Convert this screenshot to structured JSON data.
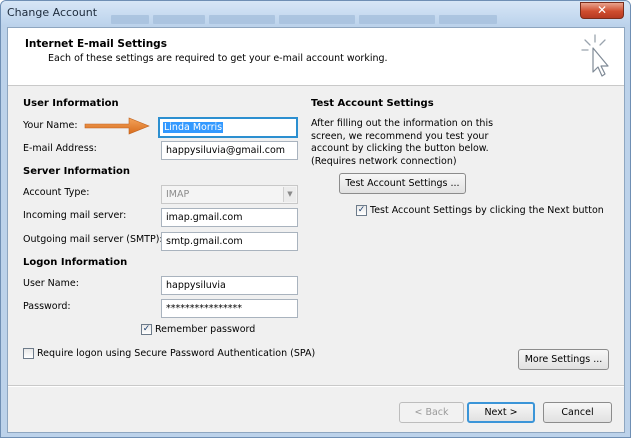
{
  "window": {
    "title": "Change Account",
    "close_glyph": "✕"
  },
  "header": {
    "title": "Internet E-mail Settings",
    "subtitle": "Each of these settings are required to get your e-mail account working.",
    "icon": "cursor-click-icon"
  },
  "user_info": {
    "heading": "User Information",
    "name_label": "Your Name:",
    "name_value": "Linda Morris",
    "email_label": "E-mail Address:",
    "email_value": "happysiluvia@gmail.com"
  },
  "server_info": {
    "heading": "Server Information",
    "account_type_label": "Account Type:",
    "account_type_value": "IMAP",
    "incoming_label": "Incoming mail server:",
    "incoming_value": "imap.gmail.com",
    "outgoing_label": "Outgoing mail server (SMTP):",
    "outgoing_value": "smtp.gmail.com"
  },
  "logon_info": {
    "heading": "Logon Information",
    "username_label": "User Name:",
    "username_value": "happysiluvia",
    "password_label": "Password:",
    "password_value": "****************",
    "remember_label": "Remember password",
    "remember_checked": true,
    "spa_label": "Require logon using Secure Password Authentication (SPA)",
    "spa_checked": false
  },
  "test_settings": {
    "heading": "Test Account Settings",
    "description": "After filling out the information on this screen, we recommend you test your account by clicking the button below. (Requires network connection)",
    "test_button": "Test Account Settings ...",
    "auto_test_label": "Test Account Settings by clicking the Next button",
    "auto_test_checked": true,
    "more_settings_button": "More Settings ..."
  },
  "footer": {
    "back_button": "< Back",
    "next_button": "Next >",
    "cancel_button": "Cancel"
  },
  "colors": {
    "arrow": "#e07b2a",
    "focus_border": "#2c8fd0",
    "selection": "#3399ff"
  }
}
